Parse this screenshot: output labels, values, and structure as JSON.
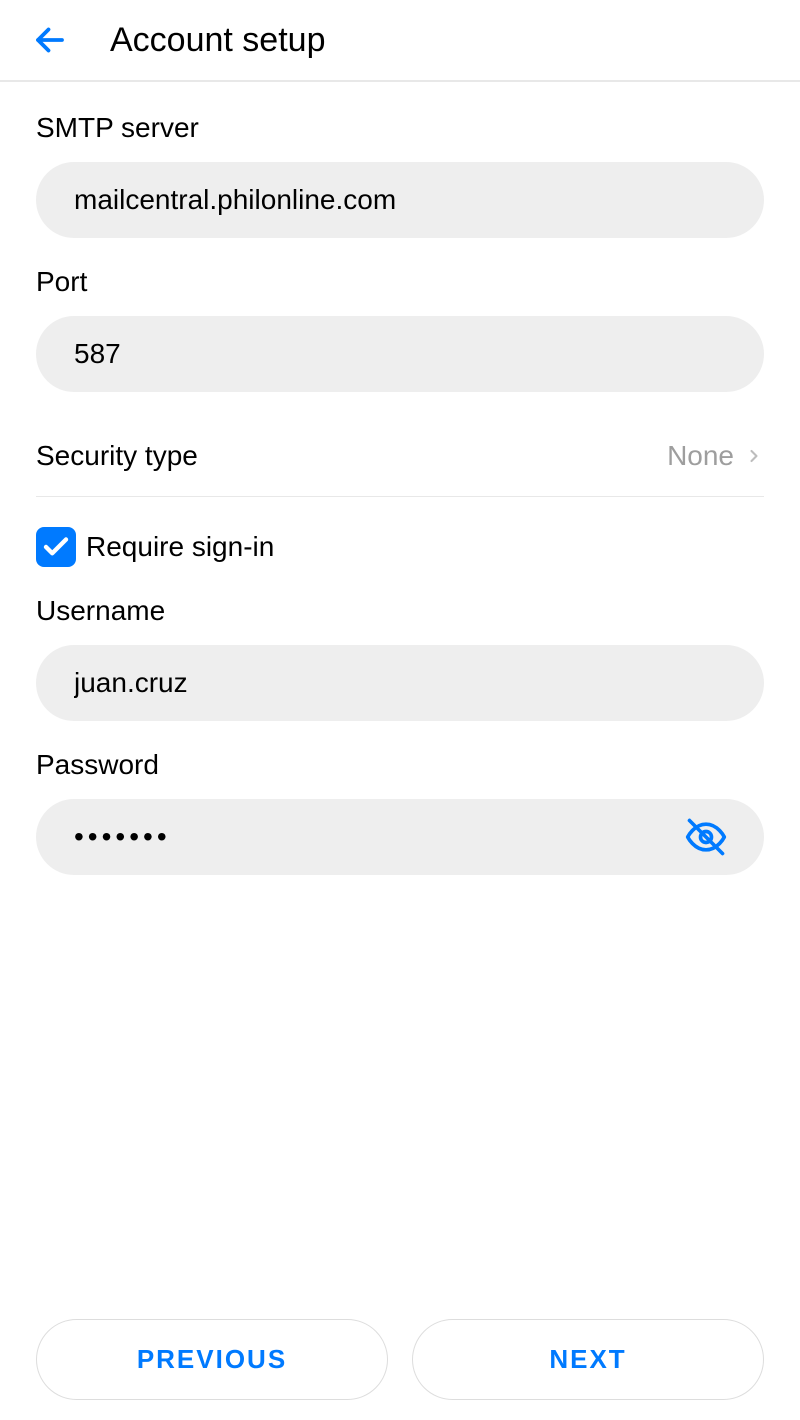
{
  "header": {
    "title": "Account setup"
  },
  "fields": {
    "smtp_server": {
      "label": "SMTP server",
      "value": "mailcentral.philonline.com"
    },
    "port": {
      "label": "Port",
      "value": "587"
    },
    "security_type": {
      "label": "Security type",
      "value": "None"
    },
    "require_signin": {
      "label": "Require sign-in",
      "checked": true
    },
    "username": {
      "label": "Username",
      "value": "juan.cruz"
    },
    "password": {
      "label": "Password",
      "value": "•••••••"
    }
  },
  "footer": {
    "previous": "PREVIOUS",
    "next": "NEXT"
  }
}
